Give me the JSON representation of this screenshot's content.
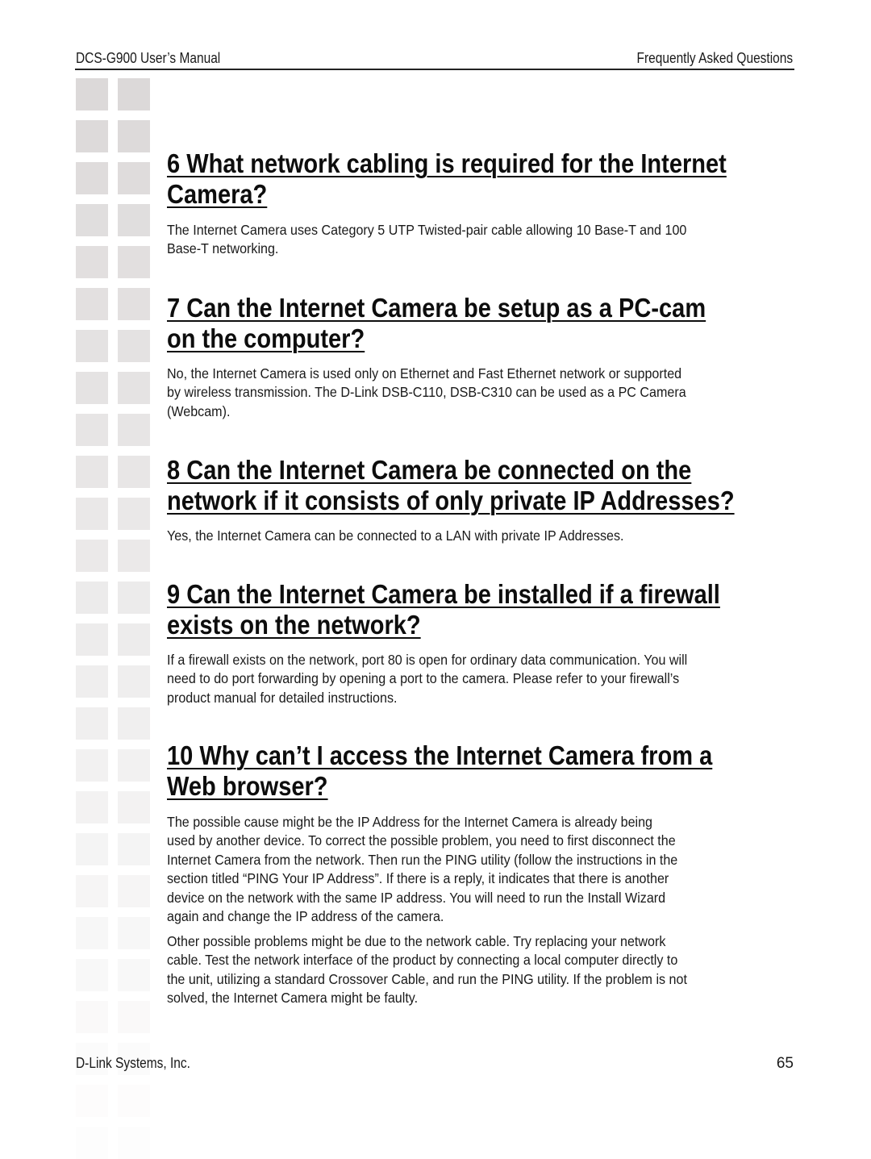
{
  "header": {
    "left": "DCS-G900 User’s Manual",
    "right": "Frequently Asked Questions"
  },
  "faq": [
    {
      "title_lines": [
        "6 What network cabling is required for the Internet ",
        "Camera?"
      ],
      "answer_paragraphs": [
        [
          "The Internet Camera uses Category 5 UTP Twisted-pair cable allowing 10 Base-T and 100",
          "Base-T networking."
        ]
      ]
    },
    {
      "title_lines": [
        "7 Can the Internet Camera be setup as a PC-cam ",
        "on the computer?"
      ],
      "answer_paragraphs": [
        [
          "No, the Internet Camera is used only on Ethernet and Fast Ethernet network or supported",
          "by wireless transmission. The D-Link DSB-C110, DSB-C310 can be used as a PC Camera",
          "(Webcam)."
        ]
      ]
    },
    {
      "title_lines": [
        "8 Can the Internet Camera be connected on the ",
        "network if it consists of only private IP Addresses?"
      ],
      "answer_paragraphs": [
        [
          "Yes, the Internet Camera can be connected to a LAN with private IP Addresses."
        ]
      ]
    },
    {
      "title_lines": [
        "9 Can the Internet Camera be installed if a firewall ",
        "exists on the network?"
      ],
      "answer_paragraphs": [
        [
          "If a firewall exists on the network, port 80 is open for ordinary data communication. You will",
          "need to do port forwarding by opening a port to the camera. Please refer to your firewall’s",
          "product manual for detailed instructions."
        ]
      ]
    },
    {
      "title_lines": [
        "10 Why can’t I access the Internet Camera from a ",
        "Web browser?"
      ],
      "answer_paragraphs": [
        [
          "The possible cause might be the IP Address for the Internet Camera is already being",
          "used by another device. To correct the possible problem, you need to first disconnect the",
          "Internet Camera from the network. Then run the PING utility (follow the instructions in the",
          "section titled “PING Your IP Address”. If there is a reply, it indicates that there is another",
          "device on the network with the same IP address. You will need to run the Install Wizard",
          "again and change the IP address of the camera."
        ],
        [
          "Other possible problems might be due to the network cable. Try replacing your network",
          "cable. Test the network interface of the product by connecting a local computer directly to",
          "the unit, utilizing a standard Crossover Cable, and run the PING utility. If the problem is not",
          "solved, the Internet Camera might be faulty."
        ]
      ]
    }
  ],
  "footer": {
    "company": "D-Link Systems, Inc.",
    "page_number": "65"
  },
  "colors": {
    "sidebar_square": "#dcd9d9",
    "text": "#111111",
    "rule": "#222222"
  }
}
